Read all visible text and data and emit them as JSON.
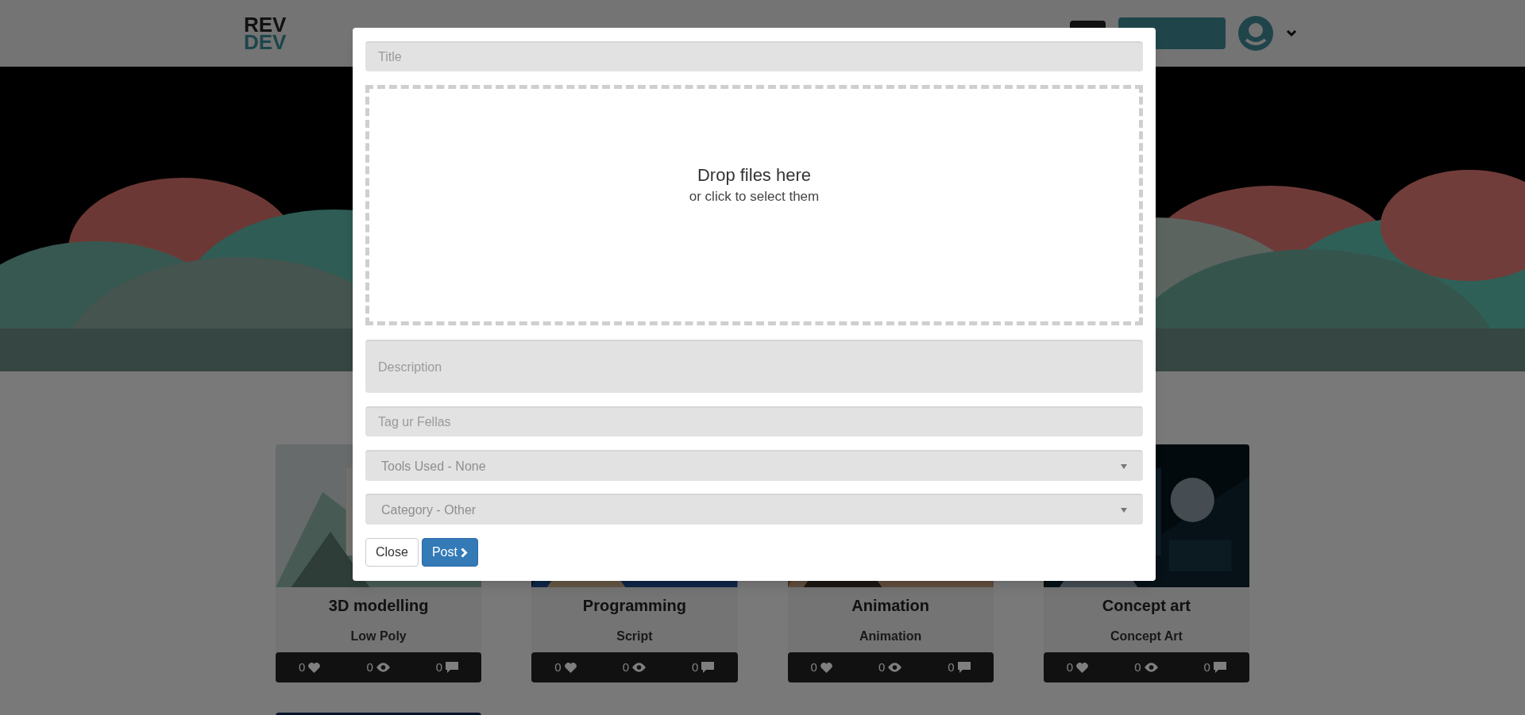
{
  "header": {
    "logo_top": "REV",
    "logo_bottom": "DEV"
  },
  "cards": [
    {
      "title": "3D modelling",
      "subtitle": "Low Poly",
      "likes": "0",
      "views": "0",
      "comments": "0"
    },
    {
      "title": "Programming",
      "subtitle": "Script",
      "likes": "0",
      "views": "0",
      "comments": "0"
    },
    {
      "title": "Animation",
      "subtitle": "Animation",
      "likes": "0",
      "views": "0",
      "comments": "0"
    },
    {
      "title": "Concept art",
      "subtitle": "Concept Art",
      "likes": "0",
      "views": "0",
      "comments": "0"
    }
  ],
  "modal": {
    "title_field": {
      "placeholder": "Title"
    },
    "dropzone": {
      "heading": "Drop files here",
      "hint": "or click to select them"
    },
    "description_field": {
      "placeholder": "Description"
    },
    "tags_field": {
      "placeholder": "Tag ur Fellas"
    },
    "tools_select": {
      "value": "Tools Used - None"
    },
    "category_select": {
      "value": "Category - Other"
    },
    "buttons": [
      {
        "label": "Close",
        "kind": "default"
      },
      {
        "label": "Post",
        "kind": "primary"
      }
    ]
  }
}
